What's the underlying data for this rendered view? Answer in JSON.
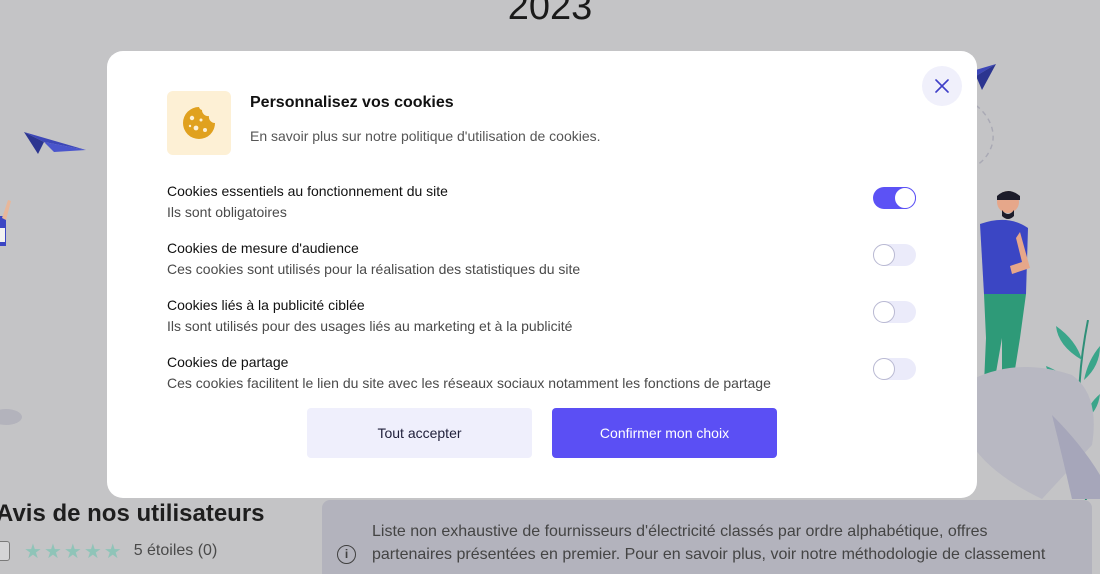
{
  "background": {
    "year": "2023",
    "reviews": {
      "title": "Avis de nos utilisateurs",
      "stars": [
        "★",
        "★",
        "★",
        "★",
        "★"
      ],
      "rating_label": "5 étoiles (0)"
    },
    "info_text": "Liste non exhaustive de fournisseurs d'électricité classés par ordre alphabétique, offres partenaires présentées en premier. Pour en savoir plus, voir notre méthodologie de classement"
  },
  "modal": {
    "title": "Personnalisez vos cookies",
    "subtitle": "En savoir plus sur notre politique d'utilisation de cookies.",
    "preferences": [
      {
        "title": "Cookies essentiels au fonctionnement du site",
        "description": "Ils sont obligatoires",
        "enabled": true
      },
      {
        "title": "Cookies de mesure d'audience",
        "description": "Ces cookies sont utilisés pour la réalisation des statistiques du site",
        "enabled": false
      },
      {
        "title": "Cookies liés à la publicité ciblée",
        "description": "Ils sont utilisés pour des usages liés au marketing et à la publicité",
        "enabled": false
      },
      {
        "title": "Cookies de partage",
        "description": "Ces cookies facilitent le lien du site avec les réseaux sociaux notamment les fonctions de partage",
        "enabled": false
      }
    ],
    "buttons": {
      "accept_all": "Tout accepter",
      "confirm": "Confirmer mon choix"
    }
  },
  "colors": {
    "accent": "#5b4ff4",
    "overlay": "#c4c4c6",
    "toggle_off": "#ebebfa",
    "cookie_badge": "#fdf0d5",
    "cookie_icon": "#e0a11f"
  },
  "icons": {
    "close": "close-icon",
    "cookie": "cookie-icon",
    "info": "info-icon",
    "star": "star-icon"
  }
}
